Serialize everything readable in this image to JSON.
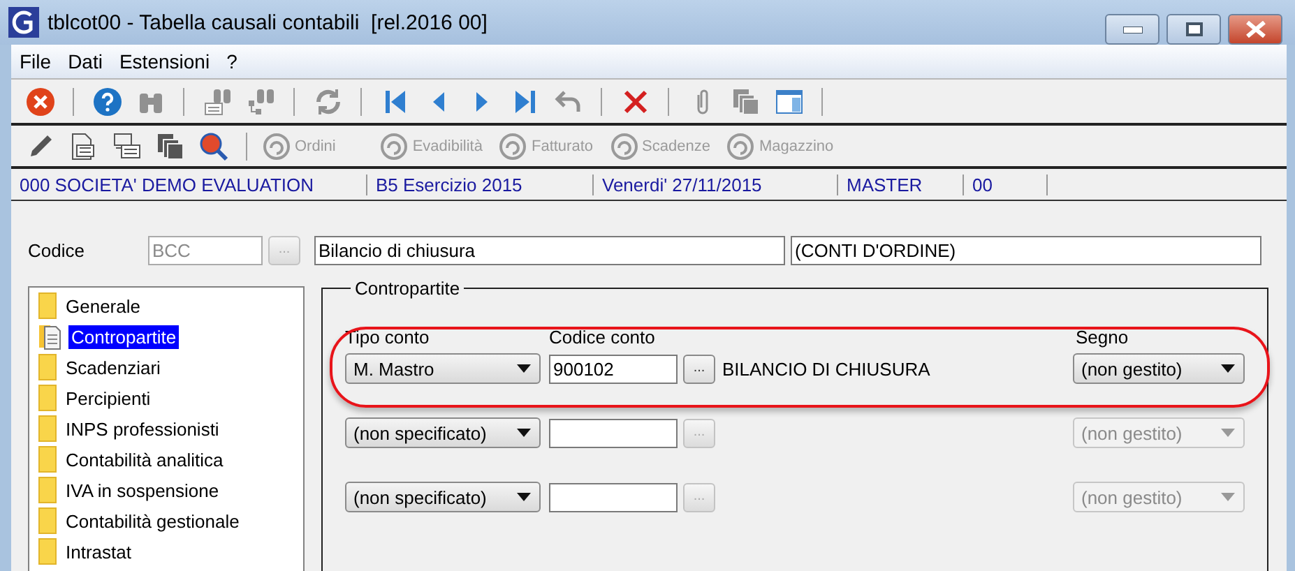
{
  "window": {
    "title": "tblcot00 - Tabella causali contabili  [rel.2016 00]"
  },
  "menu": [
    "File",
    "Dati",
    "Estensioni",
    "?"
  ],
  "toolbar": [
    {
      "kind": "close",
      "disabled": false
    },
    {
      "kind": "separator"
    },
    {
      "kind": "help",
      "disabled": false
    },
    {
      "kind": "binoculars",
      "disabled": true
    },
    {
      "kind": "separator"
    },
    {
      "kind": "find-list",
      "disabled": true
    },
    {
      "kind": "find-tree",
      "disabled": true
    },
    {
      "kind": "separator"
    },
    {
      "kind": "refresh",
      "disabled": true
    },
    {
      "kind": "separator"
    },
    {
      "kind": "first",
      "disabled": false
    },
    {
      "kind": "prev",
      "disabled": false
    },
    {
      "kind": "next",
      "disabled": false
    },
    {
      "kind": "last",
      "disabled": false
    },
    {
      "kind": "undo",
      "disabled": true
    },
    {
      "kind": "separator"
    },
    {
      "kind": "delete",
      "disabled": false
    },
    {
      "kind": "separator"
    },
    {
      "kind": "clip",
      "disabled": true
    },
    {
      "kind": "copies",
      "disabled": true
    },
    {
      "kind": "layout",
      "disabled": false
    },
    {
      "kind": "separator"
    }
  ],
  "toolbar2": [
    {
      "kind": "pencil"
    },
    {
      "kind": "form"
    },
    {
      "kind": "export"
    },
    {
      "kind": "copies"
    },
    {
      "kind": "inspect"
    },
    {
      "kind": "separator"
    },
    {
      "kind": "action",
      "label": "Ordini"
    },
    {
      "kind": "gap"
    },
    {
      "kind": "action",
      "label": "Evadibilità"
    },
    {
      "kind": "action",
      "label": "Fatturato"
    },
    {
      "kind": "action",
      "label": "Scadenze"
    },
    {
      "kind": "action",
      "label": "Magazzino"
    }
  ],
  "info_bar": [
    "000 SOCIETA'  DEMO EVALUATION",
    "B5 Esercizio 2015",
    "Venerdi' 27/11/2015",
    "MASTER",
    "00"
  ],
  "codice": {
    "label": "Codice",
    "value": "BCC",
    "browse": "...",
    "description": "Bilancio di chiusura",
    "note": "(CONTI D'ORDINE)"
  },
  "sidebar": [
    {
      "label": "Generale",
      "selected": false
    },
    {
      "label": "Contropartite",
      "selected": true
    },
    {
      "label": "Scadenziari",
      "selected": false
    },
    {
      "label": "Percipienti",
      "selected": false
    },
    {
      "label": "INPS professionisti",
      "selected": false
    },
    {
      "label": "Contabilità analitica",
      "selected": false
    },
    {
      "label": "IVA in sospensione",
      "selected": false
    },
    {
      "label": "Contabilità gestionale",
      "selected": false
    },
    {
      "label": "Intrastat",
      "selected": false
    }
  ],
  "group": {
    "title": "Contropartite",
    "columns": [
      "Tipo conto",
      "Codice conto",
      "Segno"
    ],
    "rows": [
      {
        "tipo": "M. Mastro",
        "codice": "900102",
        "browse": "...",
        "description": "BILANCIO DI CHIUSURA",
        "segno": "(non gestito)",
        "enabled": true,
        "highlighted": true
      },
      {
        "tipo": "(non specificato)",
        "browse": "...",
        "segno": "(non gestito)",
        "enabled": false,
        "highlighted": false
      },
      {
        "tipo": "(non specificato)",
        "browse": "...",
        "segno": "(non gestito)",
        "enabled": false,
        "highlighted": false
      }
    ]
  }
}
